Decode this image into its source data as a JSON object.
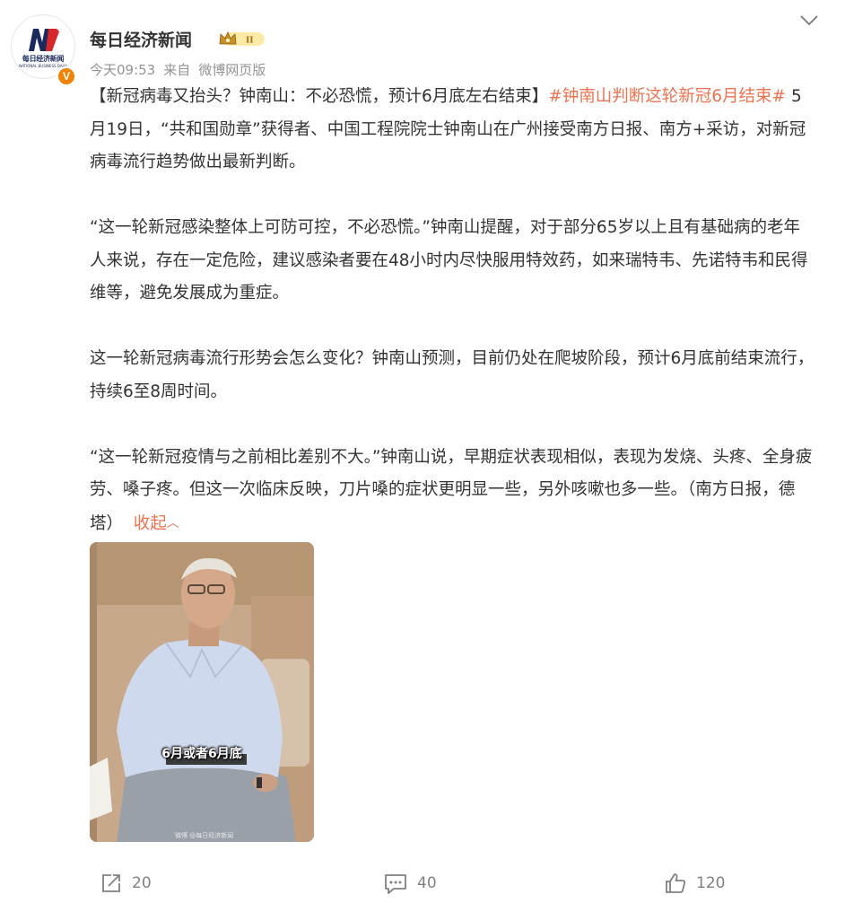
{
  "post": {
    "author": "每日经济新闻",
    "vip_badge": "II",
    "avatar": {
      "logo_text_cn": "每日经济新闻",
      "logo_text_en": "NATIONAL BUSINESS DAILY",
      "verified_badge": "V"
    },
    "timestamp": "今天09:53",
    "source_prefix": "来自",
    "source": "微博网页版",
    "headline": "【新冠病毒又抬头？钟南山：不必恐慌，预计6月底左右结束】",
    "topic_tag": "#钟南山判断这轮新冠6月结束#",
    "paragraph_1": " 5月19日，“共和国勋章”获得者、中国工程院院士钟南山在广州接受南方日报、南方+采访，对新冠病毒流行趋势做出最新判断。",
    "paragraph_2": "“这一轮新冠感染整体上可防可控，不必恐慌。”钟南山提醒，对于部分65岁以上且有基础病的老年人来说，存在一定危险，建议感染者要在48小时内尽快服用特效药，如来瑞特韦、先诺特韦和民得维等，避免发展成为重症。",
    "paragraph_3": "这一轮新冠病毒流行形势会怎么变化？钟南山预测，目前仍处在爬坡阶段，预计6月底前结束流行，持续6至8周时间。",
    "paragraph_4": "“这一轮新冠疫情与之前相比差别不大。”钟南山说，早期症状表现相似，表现为发烧、头疼、全身疲劳、嗓子疼。但这一次临床反映，刀片嗓的症状更明显一些，另外咳嗽也多一些。（南方日报，德塔）",
    "collapse_label": "收起",
    "image": {
      "caption": "6月或者6月底",
      "watermark": "微博 @每日经济新闻"
    }
  },
  "actions": {
    "repost_icon": "share-arrow-icon",
    "repost_count": "20",
    "comment_icon": "comment-bubble-icon",
    "comment_count": "40",
    "like_icon": "thumbs-up-icon",
    "like_count": "120"
  },
  "colors": {
    "accent": "#eb7350",
    "text": "#333333",
    "meta": "#939393",
    "verified": "#f08200",
    "brand_blue": "#1a2a5c",
    "brand_red": "#d7262c"
  }
}
